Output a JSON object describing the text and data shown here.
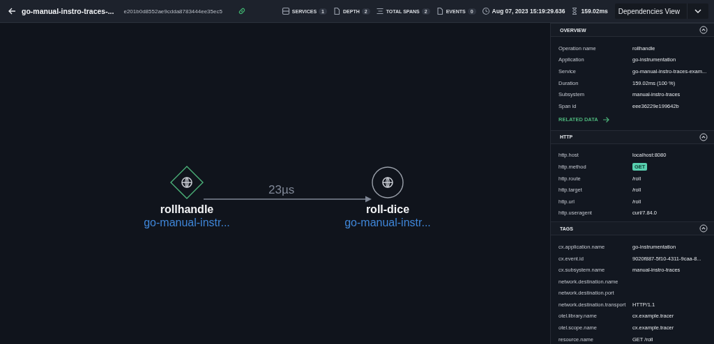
{
  "header": {
    "title": "go-manual-instro-traces-...",
    "trace_id": "e201b0d8552ae9cdda8783444ee35ec5",
    "stats": [
      {
        "kind": "services",
        "label": "SERVICES",
        "count": "1"
      },
      {
        "kind": "depth",
        "label": "DEPTH",
        "count": "2"
      },
      {
        "kind": "spans",
        "label": "TOTAL SPANS",
        "count": "2"
      },
      {
        "kind": "events",
        "label": "EVENTS",
        "count": "0"
      }
    ],
    "timestamp": "Aug 07, 2023 15:19:29.636",
    "duration": "159.02ms",
    "view": "Dependencies View"
  },
  "graph": {
    "nodes": [
      {
        "kind": "root",
        "name": "rollhandle",
        "service": "go-manual-instr..."
      },
      {
        "kind": "service",
        "name": "roll-dice",
        "service": "go-manual-instr..."
      }
    ],
    "edges": [
      {
        "label": "23µs"
      }
    ]
  },
  "panel": {
    "sections": [
      {
        "title": "OVERVIEW",
        "expanded": true,
        "rows": [
          {
            "key": "Operation name",
            "value": "rollhandle",
            "kind": "text"
          },
          {
            "key": "Application",
            "value": "go-instrumentation",
            "kind": "text"
          },
          {
            "key": "Service",
            "value": "go-manual-instro-traces-exam...",
            "kind": "text"
          },
          {
            "key": "Duration",
            "value": "159.02ms (100 %)",
            "kind": "text"
          },
          {
            "key": "Subsystem",
            "value": "manual-instro-traces",
            "kind": "text"
          },
          {
            "key": "Span id",
            "value": "eee36229e199642b",
            "kind": "text"
          }
        ],
        "link": "RELATED DATA"
      },
      {
        "title": "HTTP",
        "expanded": true,
        "rows": [
          {
            "key": "http.host",
            "value": "localhost:8080",
            "kind": "text"
          },
          {
            "key": "http.method",
            "value": "GET",
            "kind": "badge"
          },
          {
            "key": "http.route",
            "value": "/roll",
            "kind": "text"
          },
          {
            "key": "http.target",
            "value": "/roll",
            "kind": "text"
          },
          {
            "key": "http.url",
            "value": "/roll",
            "kind": "text"
          },
          {
            "key": "http.useragent",
            "value": "curl/7.84.0",
            "kind": "text"
          }
        ]
      },
      {
        "title": "TAGS",
        "expanded": true,
        "rows": [
          {
            "key": "cx.application.name",
            "value": "go-instrumentation",
            "kind": "text"
          },
          {
            "key": "cx.event.id",
            "value": "9020f887-5f10-4311-9caa-8...",
            "kind": "text"
          },
          {
            "key": "cx.subsystem.name",
            "value": "manual-instro-traces",
            "kind": "text"
          },
          {
            "key": "network.destination.name"
          },
          {
            "key": "network.destination.port"
          },
          {
            "key": "network.destination.transport",
            "value": "HTTP/1.1",
            "kind": "text"
          },
          {
            "key": "otel.library.name",
            "value": "cx.example.tracer",
            "kind": "text"
          },
          {
            "key": "otel.scope.name",
            "value": "cx.example.tracer",
            "kind": "text"
          },
          {
            "key": "resource.name",
            "value": "GET /roll",
            "kind": "text"
          }
        ]
      }
    ]
  }
}
